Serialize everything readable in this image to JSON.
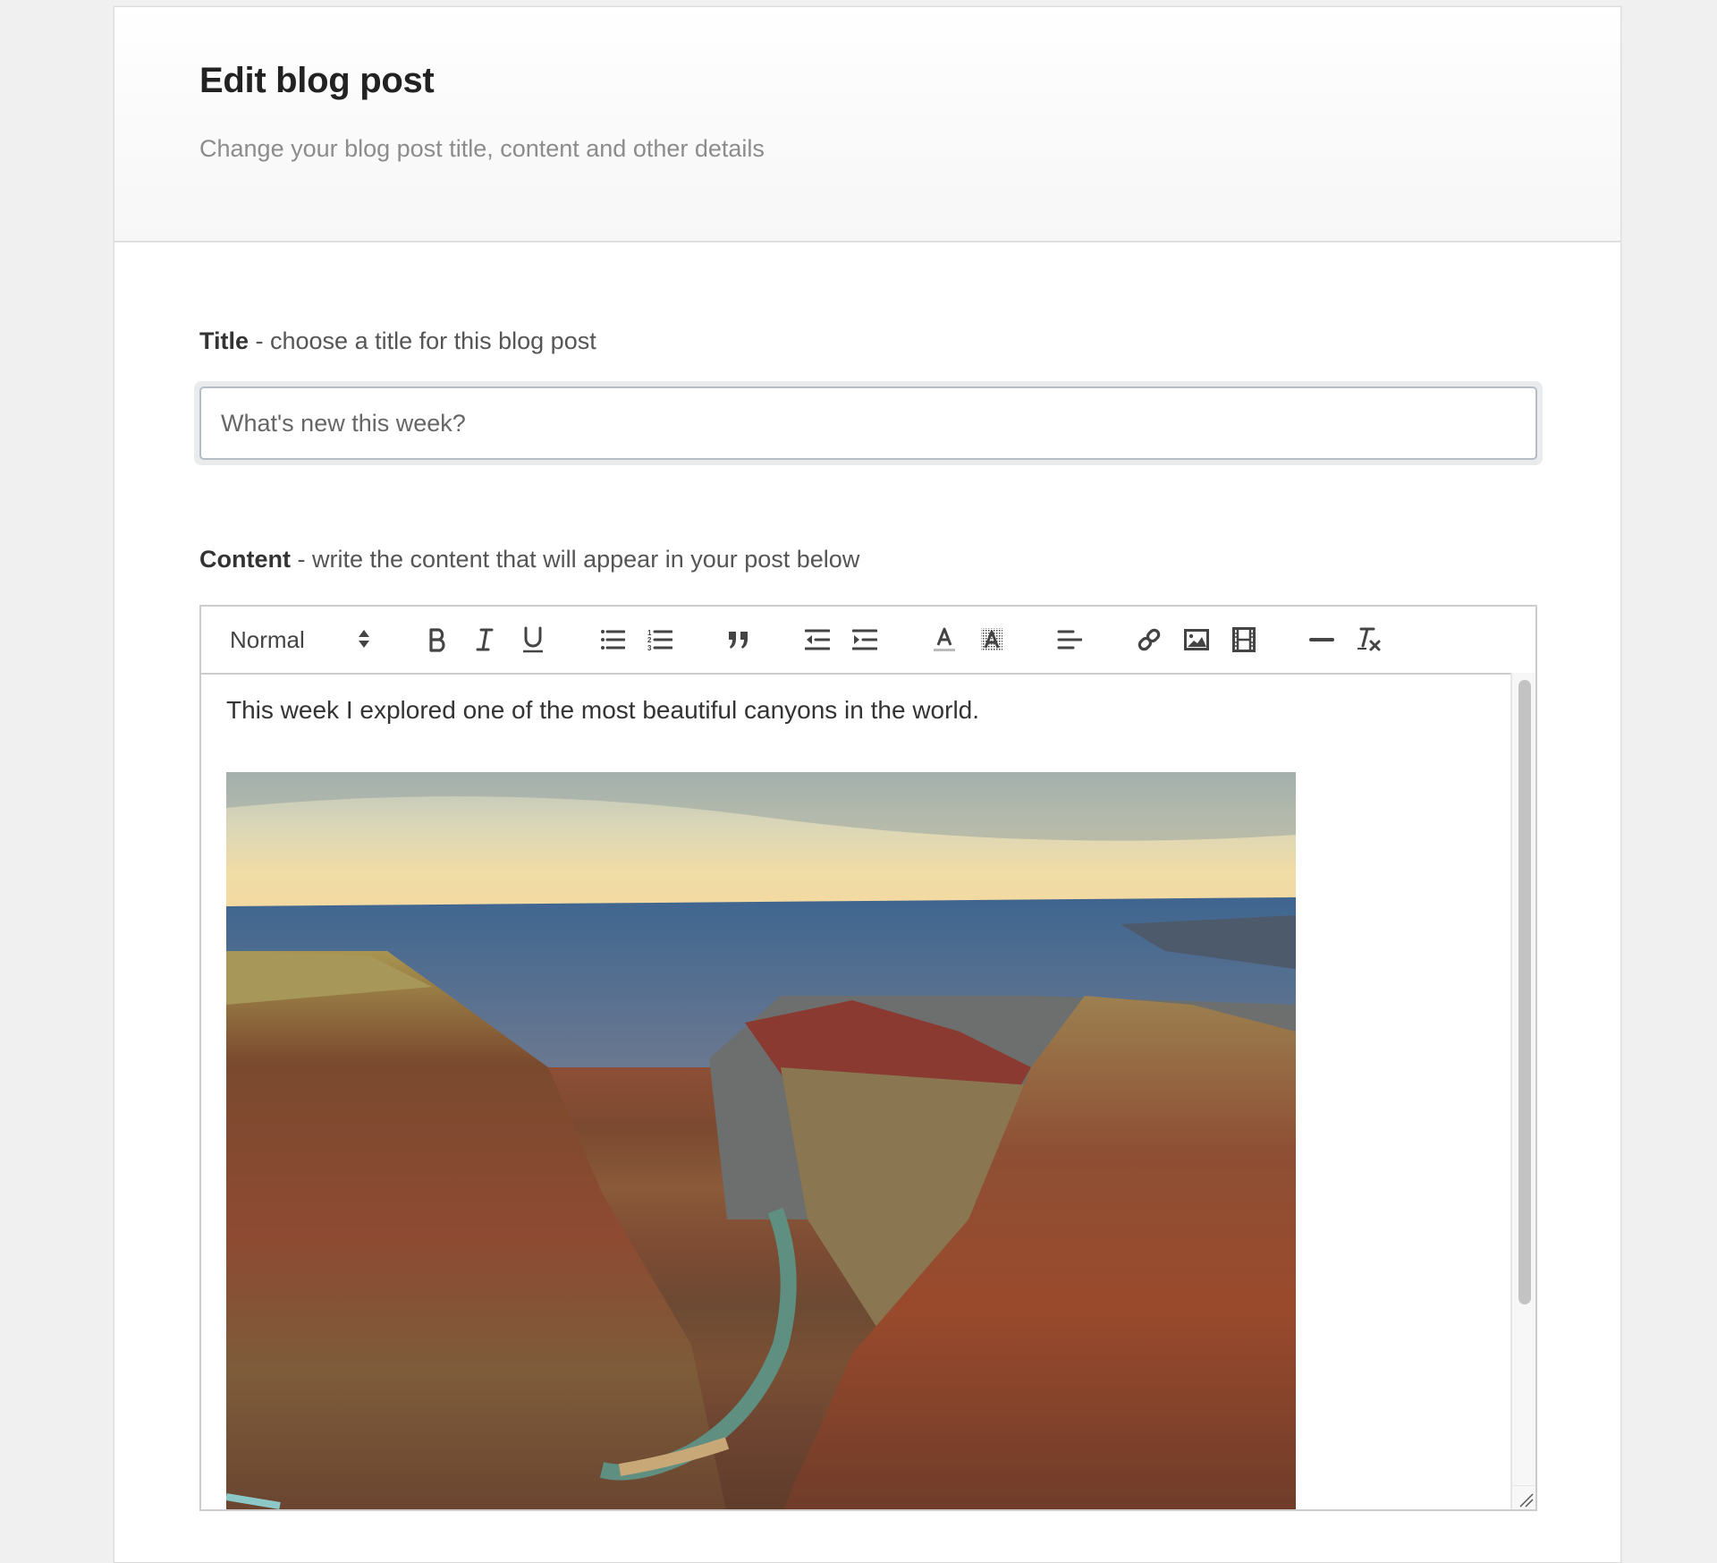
{
  "header": {
    "title": "Edit blog post",
    "subtitle": "Change your blog post title, content and other details"
  },
  "title_field": {
    "label_bold": "Title",
    "label_rest": " - choose a title for this blog post",
    "placeholder": "What's new this week?",
    "value": ""
  },
  "content_field": {
    "label_bold": "Content",
    "label_rest": " - write the content that will appear in your post below"
  },
  "editor": {
    "toolbar": {
      "header_select": {
        "selected": "Normal"
      },
      "buttons": [
        {
          "name": "bold",
          "icon": "bold-icon"
        },
        {
          "name": "italic",
          "icon": "italic-icon"
        },
        {
          "name": "underline",
          "icon": "underline-icon"
        },
        {
          "name": "bullet-list",
          "icon": "bullet-list-icon"
        },
        {
          "name": "ordered-list",
          "icon": "ordered-list-icon"
        },
        {
          "name": "blockquote",
          "icon": "quote-icon"
        },
        {
          "name": "outdent",
          "icon": "outdent-icon"
        },
        {
          "name": "indent",
          "icon": "indent-icon"
        },
        {
          "name": "text-color",
          "icon": "text-color-icon"
        },
        {
          "name": "background-color",
          "icon": "background-color-icon"
        },
        {
          "name": "align",
          "icon": "align-left-icon"
        },
        {
          "name": "link",
          "icon": "link-icon"
        },
        {
          "name": "image",
          "icon": "image-icon"
        },
        {
          "name": "video",
          "icon": "video-icon"
        },
        {
          "name": "horizontal-rule",
          "icon": "horizontal-rule-icon"
        },
        {
          "name": "clear-formatting",
          "icon": "clear-formatting-icon"
        }
      ]
    },
    "body": {
      "paragraph": "This week I explored one of the most beautiful canyons in the world.",
      "image_description": "Aerial view of a canyon with a green river winding through red rock cliffs"
    },
    "scroll_position": 0.0
  }
}
